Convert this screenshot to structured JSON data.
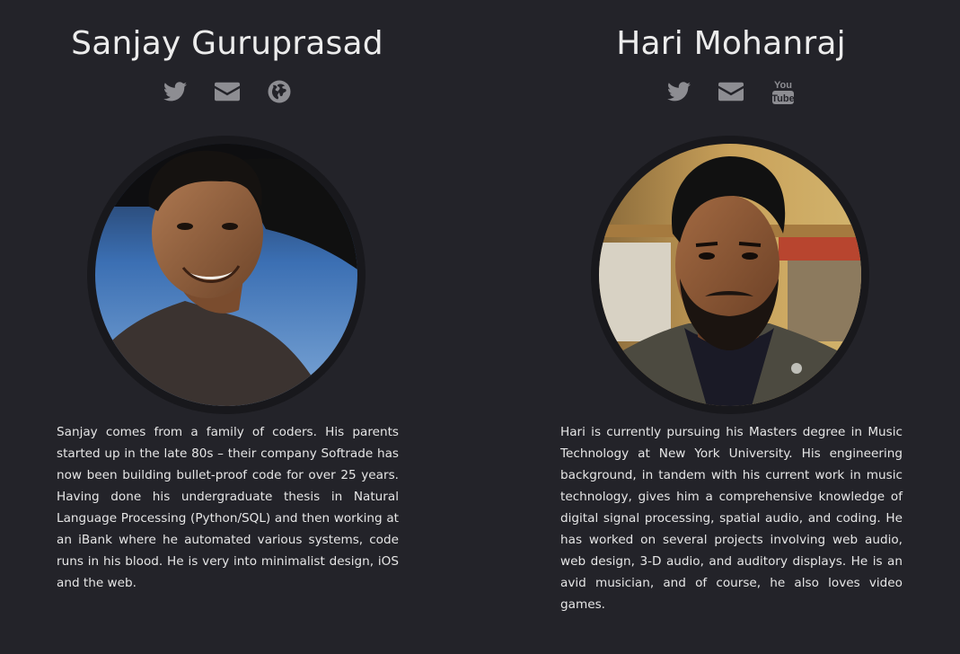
{
  "colors": {
    "background": "#232329",
    "icon": "#8d8d92",
    "text": "#e6e6e6"
  },
  "profiles": [
    {
      "name": "Sanjay Guruprasad",
      "icons": [
        "twitter-icon",
        "email-icon",
        "globe-icon"
      ],
      "bio": "Sanjay comes from a family of coders. His parents started up in the late 80s – their company Softrade has now been building bullet-proof code for over 25 years. Having done his undergraduate thesis in Natural Language Processing (Python/SQL) and then working at an iBank where he automated various systems, code runs in his blood. He is very into minimalist design, iOS and the web."
    },
    {
      "name": "Hari Mohanraj",
      "icons": [
        "twitter-icon",
        "email-icon",
        "youtube-icon"
      ],
      "youtube_icon_text": [
        "You",
        "Tube"
      ],
      "bio": "Hari is currently pursuing his Masters degree in Music Technology at New York University. His engineering background, in tandem with his current work in music technology, gives him a comprehensive knowledge of digital signal processing, spatial audio, and coding. He has worked on several projects involving web audio, web design, 3-D audio, and auditory displays. He is an avid musician, and of course, he also loves video games."
    }
  ]
}
